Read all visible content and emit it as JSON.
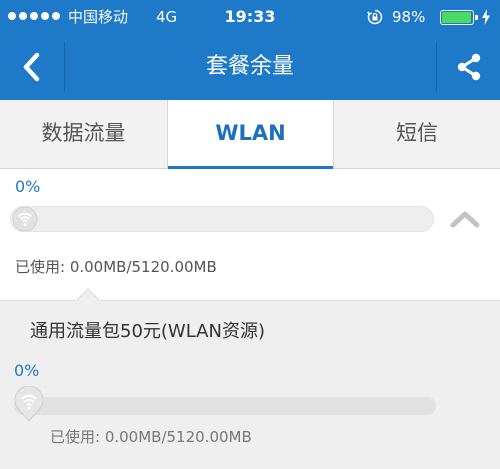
{
  "status_bar": {
    "carrier": "中国移动",
    "network": "4G",
    "time": "19:33",
    "battery_percent": "98%",
    "battery_level": 0.98,
    "signal_bars": 5,
    "icons": [
      "signal-dots-icon",
      "rotation-lock-icon",
      "battery-icon",
      "charging-bolt-icon"
    ]
  },
  "nav": {
    "title": "套餐余量",
    "back_icon": "chevron-left-icon",
    "share_icon": "share-icon"
  },
  "tabs": [
    {
      "label": "数据流量",
      "active": false
    },
    {
      "label": "WLAN",
      "active": true
    },
    {
      "label": "短信",
      "active": false
    }
  ],
  "wlan": {
    "percent": "0%",
    "usage_fraction": 0,
    "used_text": "已使用: 0.00MB/5120.00MB",
    "collapse_icon": "chevron-up-icon",
    "knob_icon": "wifi-icon"
  },
  "package": {
    "title": "通用流量包50元(WLAN资源)",
    "percent": "0%",
    "usage_fraction": 0,
    "used_text": "已使用: 0.00MB/5120.00MB",
    "knob_icon": "wifi-pin-icon"
  },
  "colors": {
    "primary": "#1f79c9",
    "active_tab_text": "#1f6fbf",
    "battery_fill": "#4cd964",
    "panel_bg": "#efefef"
  }
}
